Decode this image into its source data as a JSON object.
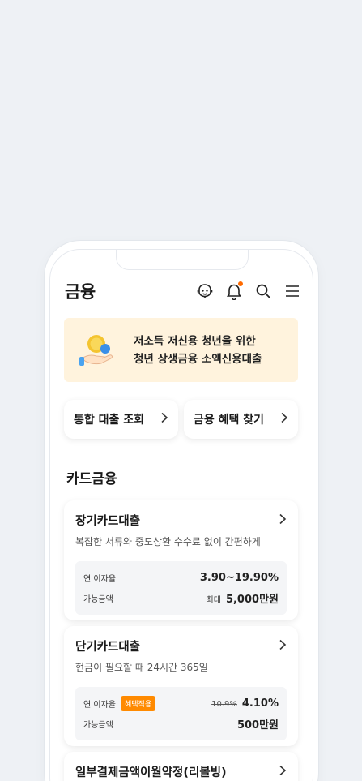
{
  "header": {
    "title": "금융",
    "icons": [
      "chatbot-icon",
      "bell-icon",
      "search-icon",
      "menu-icon"
    ],
    "notification_color": "#ff6a00"
  },
  "banner": {
    "line1": "저소득 저신용 청년을 위한",
    "line2": "청년 상생금융 소액신용대출",
    "icon": "coin-hand-icon",
    "background": "#fff3dd"
  },
  "quick_links": [
    {
      "label": "통합 대출 조회"
    },
    {
      "label": "금융 혜택 찾기"
    }
  ],
  "section": {
    "title": "카드금융"
  },
  "products": [
    {
      "title": "장기카드대출",
      "desc": "복잡한 서류와 중도상환 수수료 없이 간편하게",
      "rate_label": "연 이자율",
      "rate": "3.90~19.90%",
      "amount_label": "가능금액",
      "amount_prefix": "최대",
      "amount": "5,000만원"
    },
    {
      "title": "단기카드대출",
      "desc": "현금이 필요할 때 24시간 365일",
      "rate_label": "연 이자율",
      "badge": "혜택적용",
      "old_rate": "10.9%",
      "rate": "4.10%",
      "amount_label": "가능금액",
      "amount": "500만원"
    },
    {
      "title": "일부결제금액이월약정(리볼빙)"
    }
  ],
  "colors": {
    "accent": "#ff8a00",
    "background": "#eef1f5"
  }
}
